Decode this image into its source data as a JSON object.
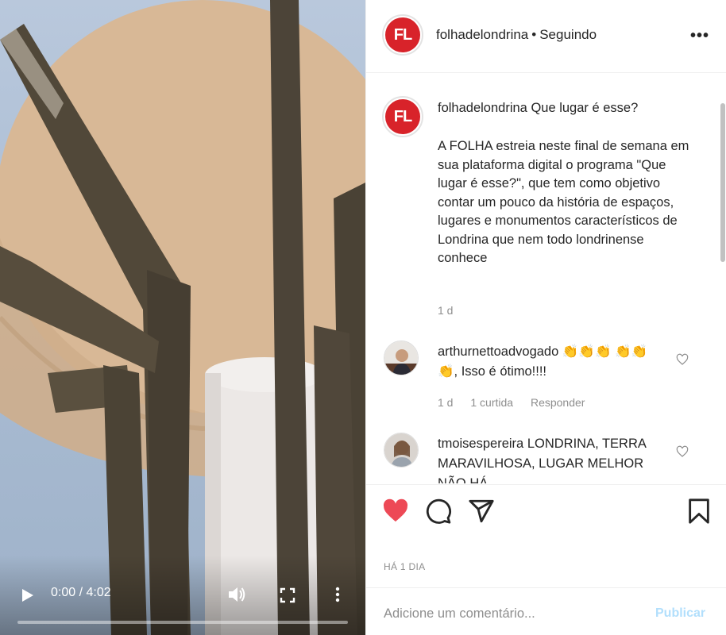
{
  "video": {
    "time_display": "0:00 / 4:02",
    "progress": 0.0,
    "icons": {
      "play": "play-icon",
      "volume": "volume-icon",
      "fullscreen": "fullscreen-icon",
      "more": "more-vertical-icon"
    }
  },
  "header": {
    "avatar_text": "FL",
    "username": "folhadelondrina",
    "separator": "•",
    "follow_status": "Seguindo",
    "more_label": "•••"
  },
  "caption": {
    "avatar_text": "FL",
    "username": "folhadelondrina",
    "title": "Que lugar é esse?",
    "body": "A FOLHA estreia neste final de semana em sua plataforma digital o programa \"Que lugar é esse?\", que tem como objetivo contar um pouco da história de espaços, lugares e monumentos característicos de Londrina que nem todo londrinense conhece",
    "time": "1 d"
  },
  "comments": [
    {
      "username": "arthurnettoadvogado",
      "text": "👏👏👏 👏👏👏, Isso é ótimo!!!!",
      "time": "1 d",
      "likes": "1 curtida",
      "reply_label": "Responder"
    },
    {
      "username": "tmoisespereira",
      "text": "LONDRINA, TERRA MARAVILHOSA, LUGAR MELHOR NÃO HÁ"
    }
  ],
  "actions": {
    "posted": "HÁ 1 DIA",
    "liked": true,
    "like_color": "#ed4956"
  },
  "add_comment": {
    "placeholder": "Adicione um comentário...",
    "publish_label": "Publicar"
  },
  "colors": {
    "brand_red": "#d8232a",
    "publish_disabled": "#b2dffc",
    "muted": "#8e8e8e"
  }
}
